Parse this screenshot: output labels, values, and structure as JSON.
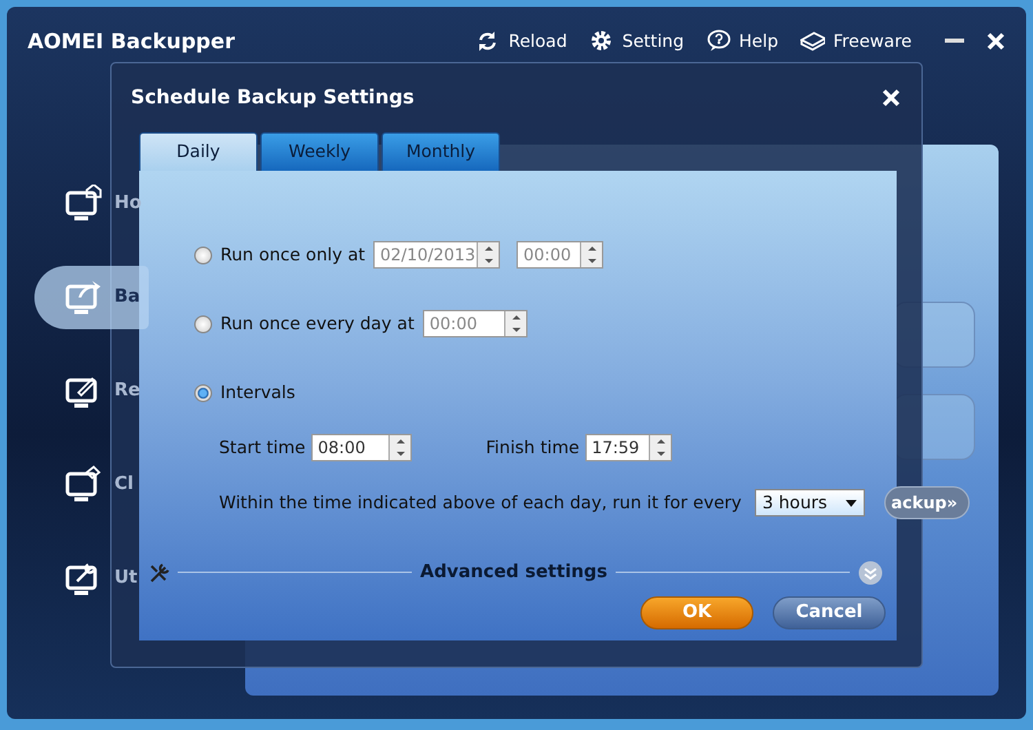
{
  "app": {
    "title": "AOMEI Backupper",
    "toolbar": [
      {
        "kind": "reload",
        "label": "Reload"
      },
      {
        "kind": "setting",
        "label": "Setting"
      },
      {
        "kind": "help",
        "label": "Help"
      },
      {
        "kind": "freeware",
        "label": "Freeware"
      }
    ]
  },
  "sidebar": {
    "items": [
      {
        "kind": "home",
        "label": "Ho",
        "selected": false
      },
      {
        "kind": "backup",
        "label": "Ba",
        "selected": true
      },
      {
        "kind": "restore",
        "label": "Re",
        "selected": false
      },
      {
        "kind": "clone",
        "label": "Cl",
        "selected": false
      },
      {
        "kind": "utilities",
        "label": "Ut",
        "selected": false
      }
    ]
  },
  "background_panel": {
    "button": "ackup»"
  },
  "dialog": {
    "title": "Schedule Backup Settings",
    "tabs": [
      {
        "label": "Daily",
        "selected": true
      },
      {
        "label": "Weekly",
        "selected": false
      },
      {
        "label": "Monthly",
        "selected": false
      }
    ],
    "options": [
      {
        "kind": "datetime",
        "label": "Run once only at",
        "selected": false,
        "date": "02/10/2013",
        "time": "00:00"
      },
      {
        "kind": "time",
        "label": "Run once every day at",
        "selected": false,
        "time": "00:00"
      },
      {
        "kind": "intervals",
        "label": "Intervals",
        "selected": true,
        "start_label": "Start time",
        "start": "08:00",
        "finish_label": "Finish time",
        "finish": "17:59",
        "every_label": "Within the time indicated above of each day, run it for every",
        "every": "3 hours"
      }
    ],
    "advanced": "Advanced settings",
    "buttons": [
      {
        "kind": "ok",
        "label": "OK"
      },
      {
        "kind": "cancel",
        "label": "Cancel"
      }
    ]
  }
}
